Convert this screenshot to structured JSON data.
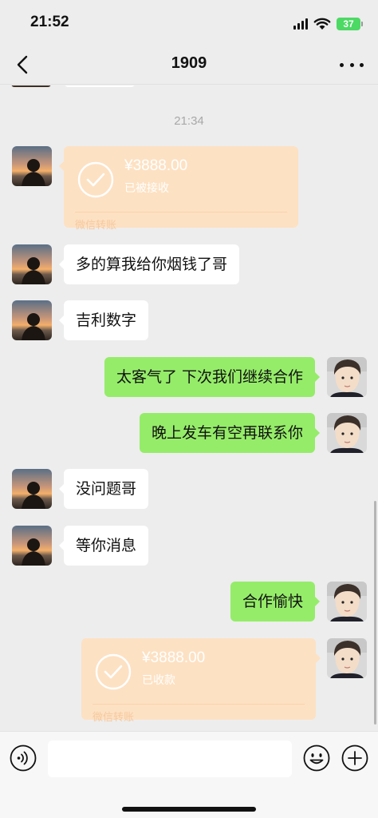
{
  "status_bar": {
    "time": "21:52",
    "battery": "37"
  },
  "nav": {
    "title": "1909",
    "back_icon": "chevron-left-icon",
    "more_icon": "more-dots-icon"
  },
  "chat": {
    "timestamp": "21:34",
    "messages": [
      {
        "type": "transfer",
        "side": "left",
        "amount": "¥3888.00",
        "status": "已被接收",
        "label": "微信转账"
      },
      {
        "type": "text",
        "side": "left",
        "text": "多的算我给你烟钱了哥"
      },
      {
        "type": "text",
        "side": "left",
        "text": "吉利数字"
      },
      {
        "type": "text",
        "side": "right",
        "text": "太客气了 下次我们继续合作"
      },
      {
        "type": "text",
        "side": "right",
        "text": "晚上发车有空再联系你"
      },
      {
        "type": "text",
        "side": "left",
        "text": "没问题哥"
      },
      {
        "type": "text",
        "side": "left",
        "text": "等你消息"
      },
      {
        "type": "text",
        "side": "right",
        "text": "合作愉快"
      },
      {
        "type": "transfer",
        "side": "right",
        "amount": "¥3888.00",
        "status": "已收款",
        "label": "微信转账"
      }
    ]
  },
  "input_bar": {
    "placeholder": "",
    "voice_icon": "voice-icon",
    "emoji_icon": "emoji-icon",
    "add_icon": "plus-icon"
  },
  "colors": {
    "background": "#ededed",
    "bubble_green": "#95ec69",
    "bubble_white": "#ffffff",
    "transfer_bg": "#fde1c3",
    "timestamp_text": "#a8a8a8"
  }
}
